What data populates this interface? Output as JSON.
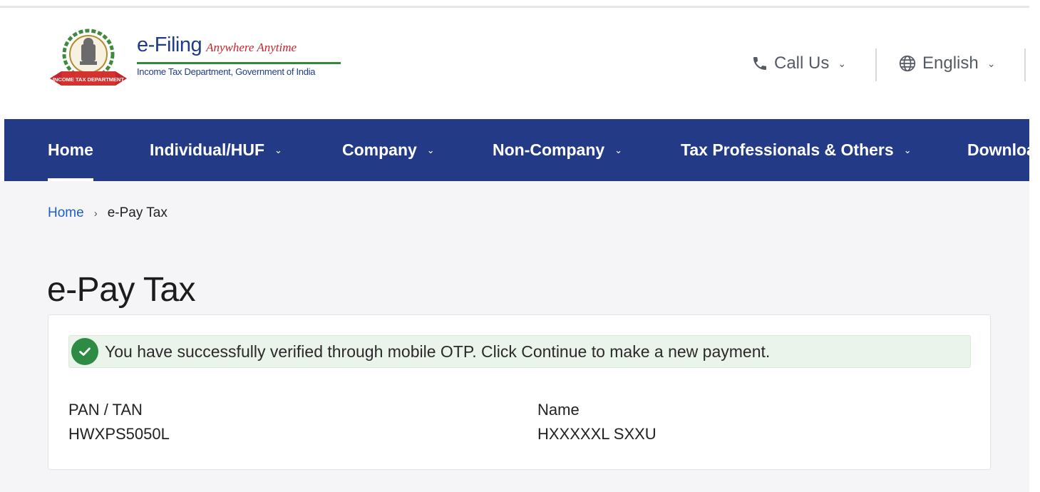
{
  "header": {
    "brand_name": "e-Filing",
    "brand_tagline": "Anywhere Anytime",
    "brand_subtitle": "Income Tax Department, Government of India",
    "emblem_ribbon_text": "INCOME TAX DEPARTMENT",
    "call_us_label": "Call Us",
    "language_label": "English"
  },
  "nav": {
    "items": [
      {
        "label": "Home"
      },
      {
        "label": "Individual/HUF"
      },
      {
        "label": "Company"
      },
      {
        "label": "Non-Company"
      },
      {
        "label": "Tax Professionals & Others"
      },
      {
        "label": "Downloa"
      }
    ]
  },
  "breadcrumb": {
    "home": "Home",
    "separator": "›",
    "current": "e-Pay Tax"
  },
  "page": {
    "title": "e-Pay Tax",
    "success_message": "You have successfully verified through mobile OTP. Click Continue to make a new payment."
  },
  "fields": {
    "pan_label": "PAN / TAN",
    "pan_value": "HWXPS5050L",
    "name_label": "Name",
    "name_value": "HXXXXXL SXXU"
  },
  "icons": {
    "emblem": "national-emblem-icon",
    "call": "phone-icon",
    "language": "globe-icon",
    "chevron": "chevron-down-icon",
    "success": "check-circle-icon"
  },
  "colors": {
    "nav_bg": "#233a86",
    "brand_blue": "#1f3c88",
    "tagline_red": "#c8242b",
    "success_green": "#2e8b44",
    "alert_bg": "#eaf4ea",
    "link_blue": "#1f5fbf"
  }
}
